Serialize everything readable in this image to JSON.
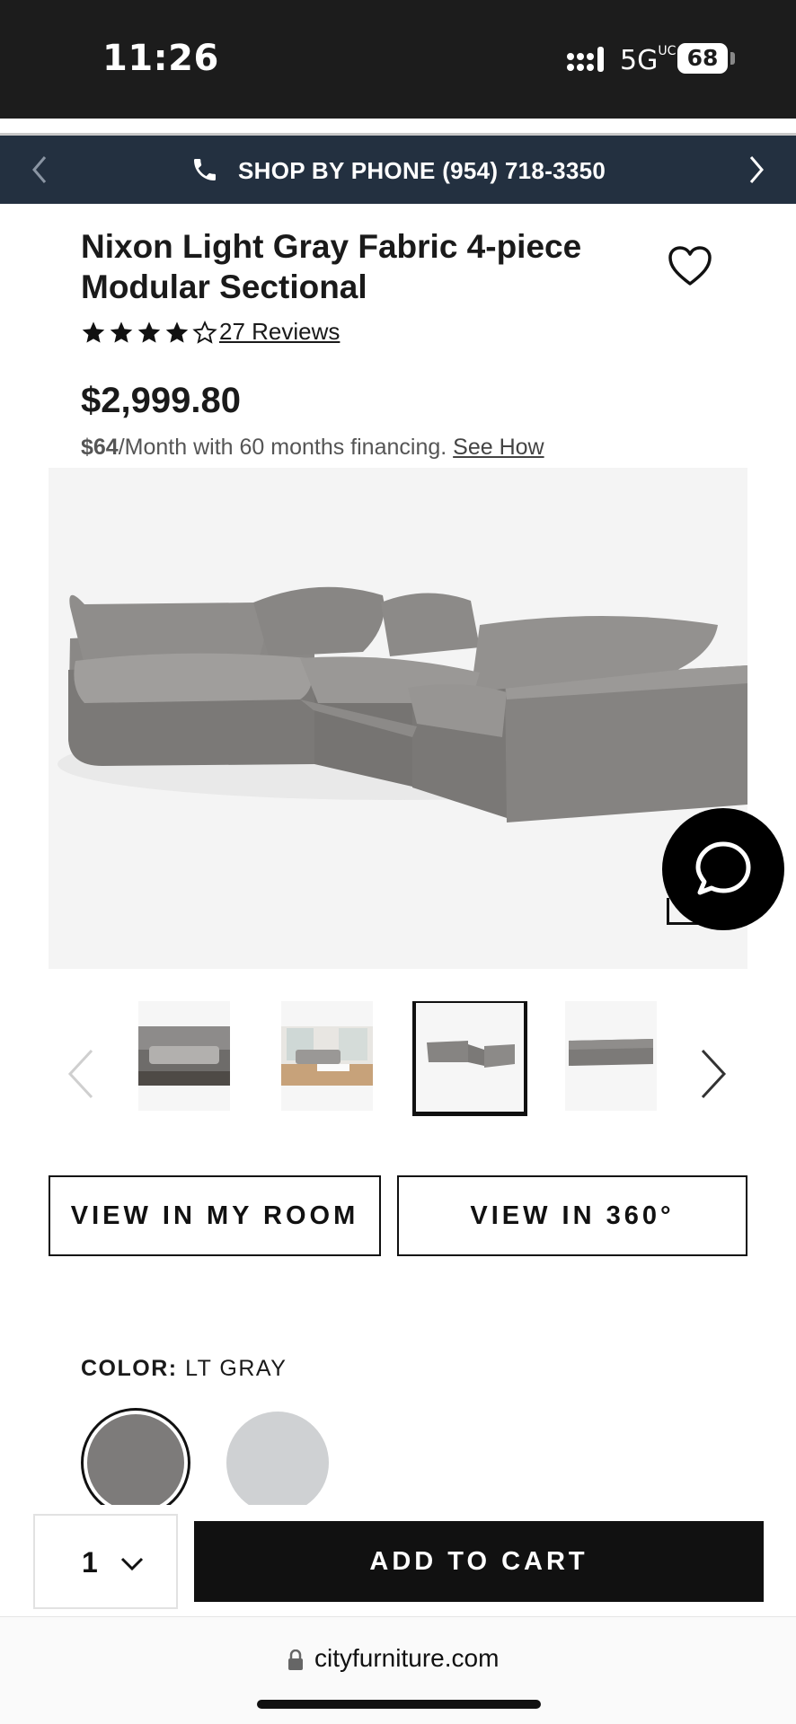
{
  "status_bar": {
    "time": "11:26",
    "network": "5G",
    "network_sup": "UC",
    "battery": "68"
  },
  "banner": {
    "text": "SHOP BY PHONE (954) 718-3350",
    "icons": [
      "chevron-left-icon",
      "phone-icon",
      "chevron-right-icon"
    ]
  },
  "product": {
    "title": "Nixon Light Gray Fabric 4-piece Modular Sectional",
    "rating": 4,
    "rating_max": 5,
    "reviews_label": "27 Reviews",
    "price": "$2,999.80",
    "financing": {
      "monthly": "$64",
      "text": "/Month with 60 months financing.",
      "link": "See How"
    }
  },
  "gallery": {
    "thumbnail_count": 4,
    "active_index": 2
  },
  "actions": {
    "view_in_room": "VIEW IN MY ROOM",
    "view_360": "VIEW IN 360°"
  },
  "color": {
    "label": "COLOR:",
    "selected": "LT GRAY",
    "swatches": [
      {
        "name": "LT GRAY",
        "hex": "#7d7b7a"
      },
      {
        "name": "light",
        "hex": "#cfd1d3"
      }
    ]
  },
  "cart": {
    "quantity": "1",
    "add_label": "ADD TO CART"
  },
  "browser": {
    "url": "cityfurniture.com"
  },
  "colors": {
    "banner_bg": "#233040",
    "status_bg": "#1c1c1c",
    "button_black": "#111111",
    "image_bg": "#f4f4f4"
  }
}
